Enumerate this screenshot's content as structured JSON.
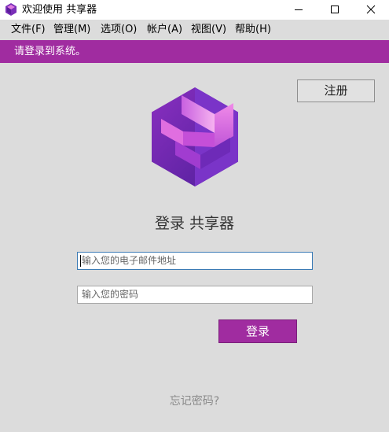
{
  "window": {
    "title": "欢迎使用 共享器"
  },
  "window_controls": {
    "minimize": "minimize",
    "maximize": "maximize",
    "close": "close"
  },
  "menu": {
    "items": [
      "文件(F)",
      "管理(M)",
      "选项(O)",
      "帐户(A)",
      "视图(V)",
      "帮助(H)"
    ]
  },
  "banner": {
    "text": "请登录到系统。",
    "color": "#a02ca0"
  },
  "register_label": "注册",
  "login": {
    "title": "登录 共享器",
    "email_placeholder": "输入您的电子邮件地址",
    "password_placeholder": "输入您的密码",
    "submit_label": "登录",
    "forgot_label": "忘记密码?"
  },
  "colors": {
    "accent": "#a02ca0",
    "background": "#dcdcdc",
    "focus_border": "#3b7bb5"
  },
  "icons": {
    "app": "hexagon-logo-icon",
    "logo": "hexagon-logo-icon"
  }
}
